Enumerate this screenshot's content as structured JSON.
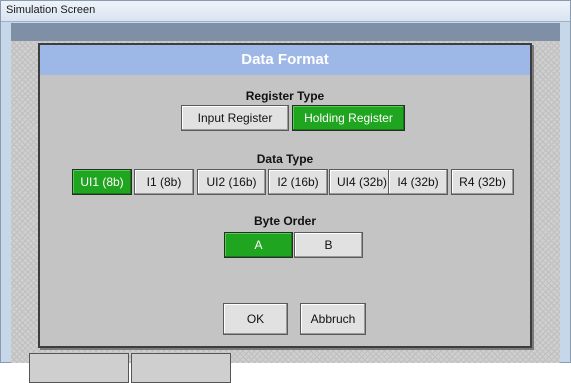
{
  "window": {
    "title": "Simulation Screen"
  },
  "dialog": {
    "title": "Data Format",
    "register_type": {
      "label": "Register Type",
      "options": [
        "Input Register",
        "Holding Register"
      ],
      "selected": "Holding Register"
    },
    "data_type": {
      "label": "Data Type",
      "options": [
        "UI1 (8b)",
        "I1 (8b)",
        "UI2 (16b)",
        "I2 (16b)",
        "UI4 (32b)",
        "I4 (32b)",
        "R4 (32b)"
      ],
      "selected": "UI1 (8b)"
    },
    "byte_order": {
      "label": "Byte Order",
      "options": [
        "A",
        "B"
      ],
      "selected": "A"
    },
    "ok_label": "OK",
    "cancel_label": "Abbruch"
  },
  "colors": {
    "selected_green": "#1fa51f",
    "header_blue": "#9db7e6"
  }
}
